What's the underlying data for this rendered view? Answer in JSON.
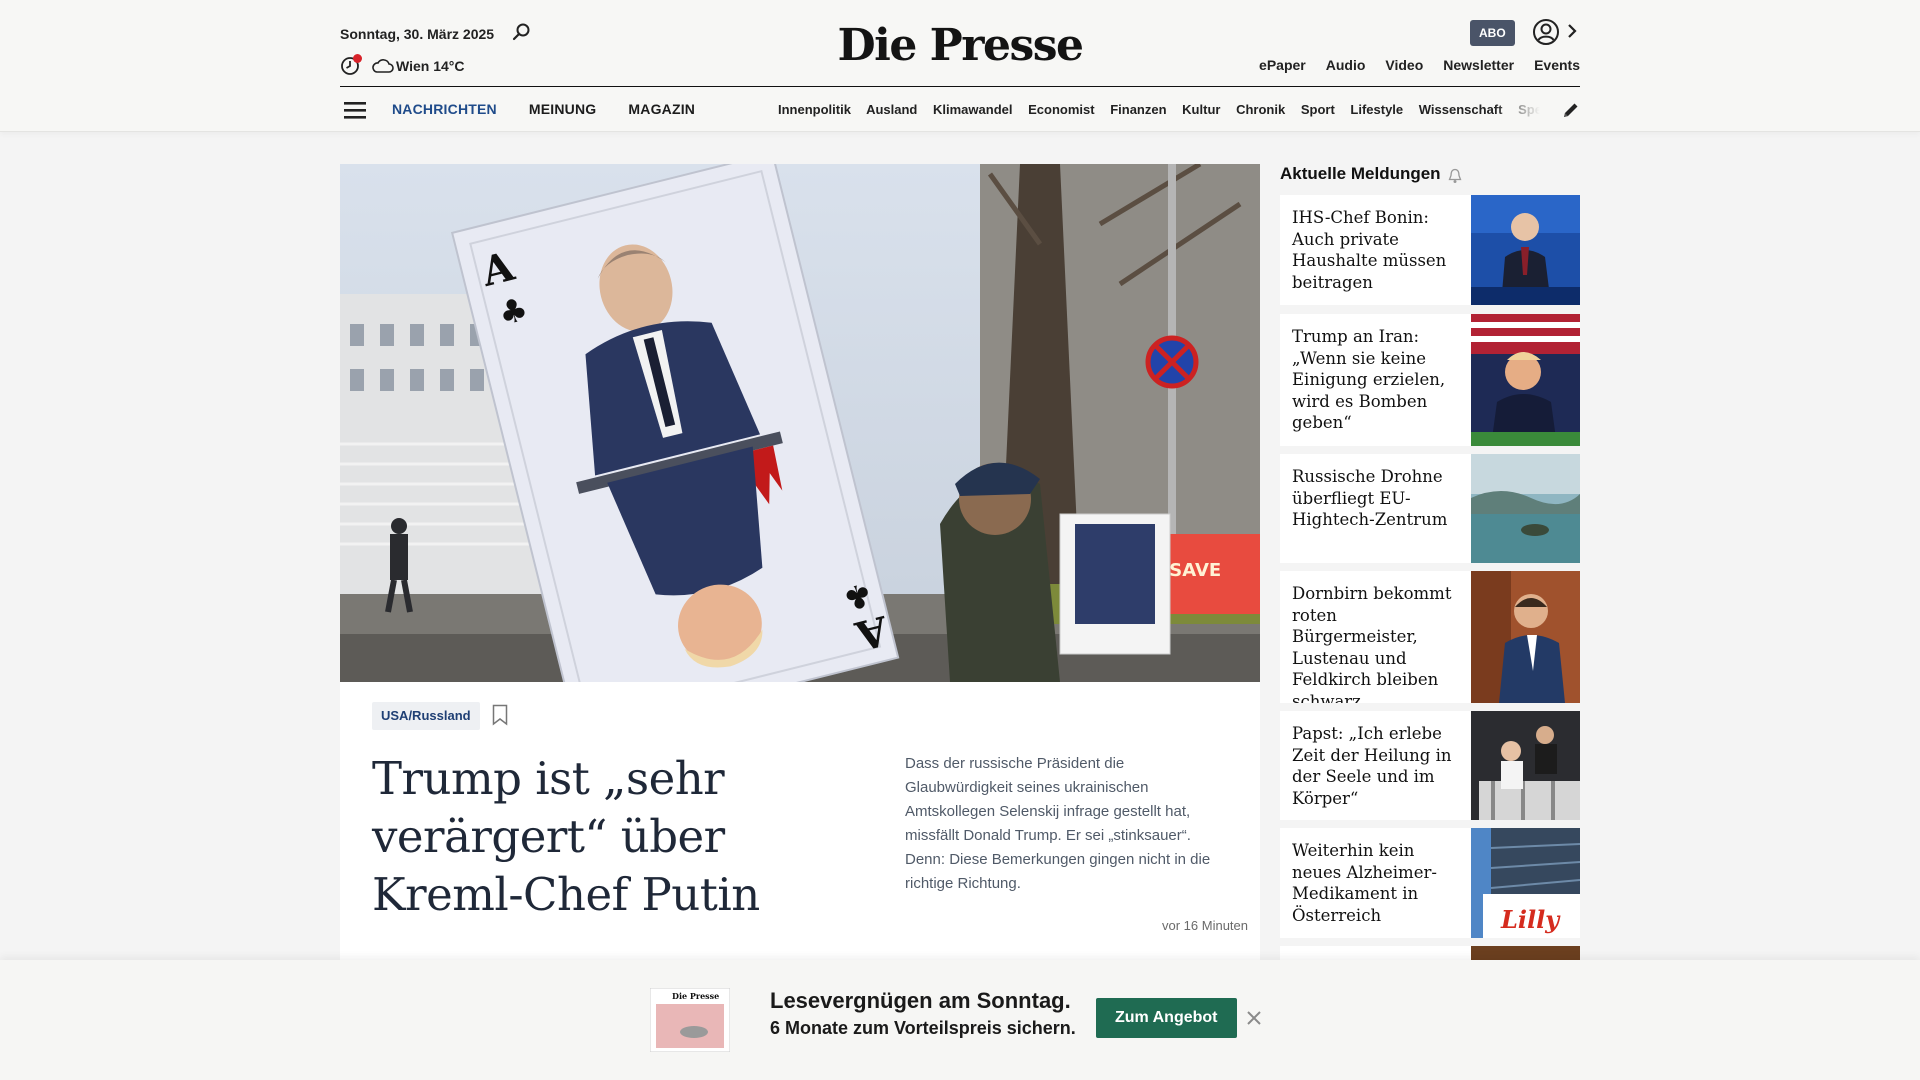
{
  "header": {
    "date": "Sonntag, 30. März 2025",
    "weather": "Wien 14°C",
    "logo": "Die Presse",
    "abo": "ABO",
    "top_links": [
      "ePaper",
      "Audio",
      "Video",
      "Newsletter",
      "Events"
    ],
    "main_nav": [
      "NACHRICHTEN",
      "MEINUNG",
      "MAGAZIN"
    ],
    "sub_nav": [
      "Innenpolitik",
      "Ausland",
      "Klimawandel",
      "Economist",
      "Finanzen",
      "Kultur",
      "Chronik",
      "Sport",
      "Lifestyle",
      "Wissenschaft",
      "Spectrum"
    ],
    "icons": [
      "search-icon",
      "clock-icon",
      "cloud-icon",
      "user-icon",
      "chevron-right-icon",
      "menu-icon",
      "pencil-icon"
    ]
  },
  "lead": {
    "tag": "USA/Russland",
    "headline": "Trump ist „sehr verärgert“ über Kreml-Chef Putin",
    "teaser": "Dass der russische Präsident die Glaubwürdigkeit seines ukrainischen Amtskollegen Selenskij infrage gestellt hat, missfällt Donald Trump. Er sei „stinksauer“. Denn: Diese Bemerkungen gingen nicht in die richtige Richtung.",
    "time": "vor 16 Minuten"
  },
  "sidebar": {
    "title": "Aktuelle Meldungen",
    "items": [
      {
        "title": "IHS-Chef Bonin: Auch private Haushalte müssen beitragen"
      },
      {
        "title": "Trump an Iran: „Wenn sie keine Einigung erzielen, wird es Bomben geben“"
      },
      {
        "title": "Russische Drohne überfliegt EU-Hightech-Zentrum"
      },
      {
        "title": "Dornbirn bekommt roten Bürgermeister, Lustenau und Feldkirch bleiben schwarz"
      },
      {
        "title": "Papst: „Ich erlebe Zeit der Heilung in der Seele und im Körper“"
      },
      {
        "title": "Weiterhin kein neues Alzheimer-Medikament in Österreich"
      }
    ]
  },
  "promo": {
    "headline": "Lesevergnügen am Sonntag.",
    "subline": "6 Monate zum Vorteilspreis sichern.",
    "button": "Zum Angebot"
  },
  "colors": {
    "accent": "#1f4b8a",
    "abo": "#4a5468",
    "cta": "#1f6b52",
    "notification": "#d8232a"
  }
}
